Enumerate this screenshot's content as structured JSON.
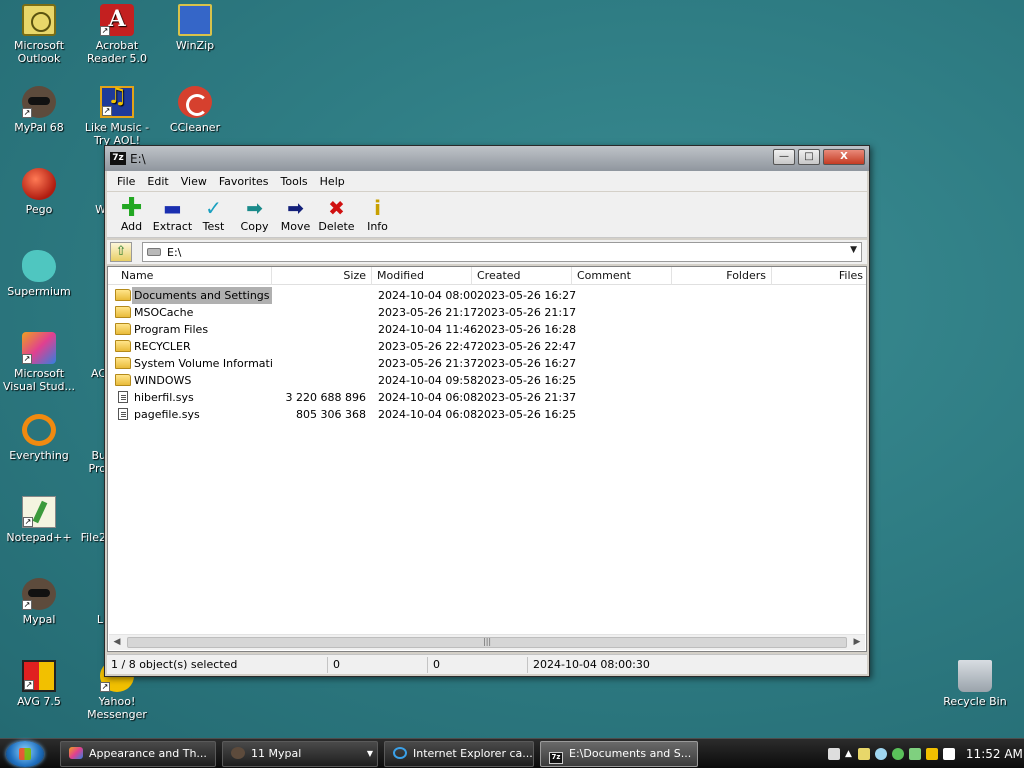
{
  "desktop": {
    "icons": [
      {
        "label": "Microsoft Outlook",
        "icon": "outlook-icon"
      },
      {
        "label": "Acrobat Reader 5.0",
        "icon": "acrobat-reader-icon"
      },
      {
        "label": "WinZip",
        "icon": "winzip-icon"
      },
      {
        "label": "MyPal 68",
        "icon": "mypal-icon"
      },
      {
        "label": "Like Music - Try AOL!",
        "icon": "aol-music-icon"
      },
      {
        "label": "CCleaner",
        "icon": "ccleaner-icon"
      },
      {
        "label": "Pego",
        "icon": "pego-icon"
      },
      {
        "label": "W",
        "icon": "partially-hidden-icon"
      },
      {
        "label": "Supermium",
        "icon": "supermium-icon"
      },
      {
        "label": "Microsoft Visual Stud...",
        "icon": "visual-studio-icon"
      },
      {
        "label": "AC",
        "icon": "partially-hidden-icon"
      },
      {
        "label": "Everything",
        "icon": "everything-icon"
      },
      {
        "label": "Bu Pro",
        "icon": "partially-hidden-icon"
      },
      {
        "label": "Notepad++",
        "icon": "notepad-plus-plus-icon"
      },
      {
        "label": "File2",
        "icon": "partially-hidden-icon"
      },
      {
        "label": "Mypal",
        "icon": "mypal-icon"
      },
      {
        "label": "Li",
        "icon": "partially-hidden-icon"
      },
      {
        "label": "AVG 7.5",
        "icon": "avg-icon"
      },
      {
        "label": "Yahoo! Messenger",
        "icon": "yahoo-messenger-icon"
      },
      {
        "label": "Recycle Bin",
        "icon": "recycle-bin-icon"
      }
    ]
  },
  "window": {
    "title": "E:\\",
    "app_icon_text": "7z",
    "controls": {
      "minimize": "—",
      "maximize": "□",
      "close": "X"
    },
    "menu": [
      "File",
      "Edit",
      "View",
      "Favorites",
      "Tools",
      "Help"
    ],
    "toolbar": [
      {
        "label": "Add",
        "icon": "add-icon",
        "glyph": "✚"
      },
      {
        "label": "Extract",
        "icon": "extract-icon",
        "glyph": "▬"
      },
      {
        "label": "Test",
        "icon": "test-icon",
        "glyph": "✓"
      },
      {
        "label": "Copy",
        "icon": "copy-icon",
        "glyph": "➡"
      },
      {
        "label": "Move",
        "icon": "move-icon",
        "glyph": "➡"
      },
      {
        "label": "Delete",
        "icon": "delete-icon",
        "glyph": "✖"
      },
      {
        "label": "Info",
        "icon": "info-icon",
        "glyph": "i"
      }
    ],
    "address": {
      "path": "E:\\",
      "up_glyph": "⇧"
    },
    "columns": {
      "name": "Name",
      "size": "Size",
      "modified": "Modified",
      "created": "Created",
      "comment": "Comment",
      "folders": "Folders",
      "files": "Files"
    },
    "rows": [
      {
        "type": "folder",
        "name": "Documents and Settings",
        "size": "",
        "modified": "2024-10-04 08:00",
        "created": "2023-05-26 16:27",
        "selected": true
      },
      {
        "type": "folder",
        "name": "MSOCache",
        "size": "",
        "modified": "2023-05-26 21:17",
        "created": "2023-05-26 21:17",
        "selected": false
      },
      {
        "type": "folder",
        "name": "Program Files",
        "size": "",
        "modified": "2024-10-04 11:46",
        "created": "2023-05-26 16:28",
        "selected": false
      },
      {
        "type": "folder",
        "name": "RECYCLER",
        "size": "",
        "modified": "2023-05-26 22:47",
        "created": "2023-05-26 22:47",
        "selected": false
      },
      {
        "type": "folder",
        "name": "System Volume Informati...",
        "size": "",
        "modified": "2023-05-26 21:37",
        "created": "2023-05-26 16:27",
        "selected": false
      },
      {
        "type": "folder",
        "name": "WINDOWS",
        "size": "",
        "modified": "2024-10-04 09:58",
        "created": "2023-05-26 16:25",
        "selected": false
      },
      {
        "type": "file",
        "name": "hiberfil.sys",
        "size": "3 220 688 896",
        "modified": "2024-10-04 06:08",
        "created": "2023-05-26 21:37",
        "selected": false
      },
      {
        "type": "file",
        "name": "pagefile.sys",
        "size": "805 306 368",
        "modified": "2024-10-04 06:08",
        "created": "2023-05-26 16:25",
        "selected": false
      }
    ],
    "status": {
      "selection": "1 / 8 object(s) selected",
      "size": "0",
      "packed": "0",
      "datetime": "2024-10-04 08:00:30"
    }
  },
  "taskbar": {
    "tasks": [
      {
        "label": "Appearance and Th...",
        "icon": "control-panel-icon",
        "active": false
      },
      {
        "label": "11 Mypal",
        "icon": "mypal-icon",
        "active": false
      },
      {
        "label": "Internet Explorer ca...",
        "icon": "internet-explorer-icon",
        "active": false
      },
      {
        "label": "E:\\Documents and S...",
        "icon": "7zip-icon",
        "active": true
      }
    ],
    "clock": "11:52 AM"
  }
}
